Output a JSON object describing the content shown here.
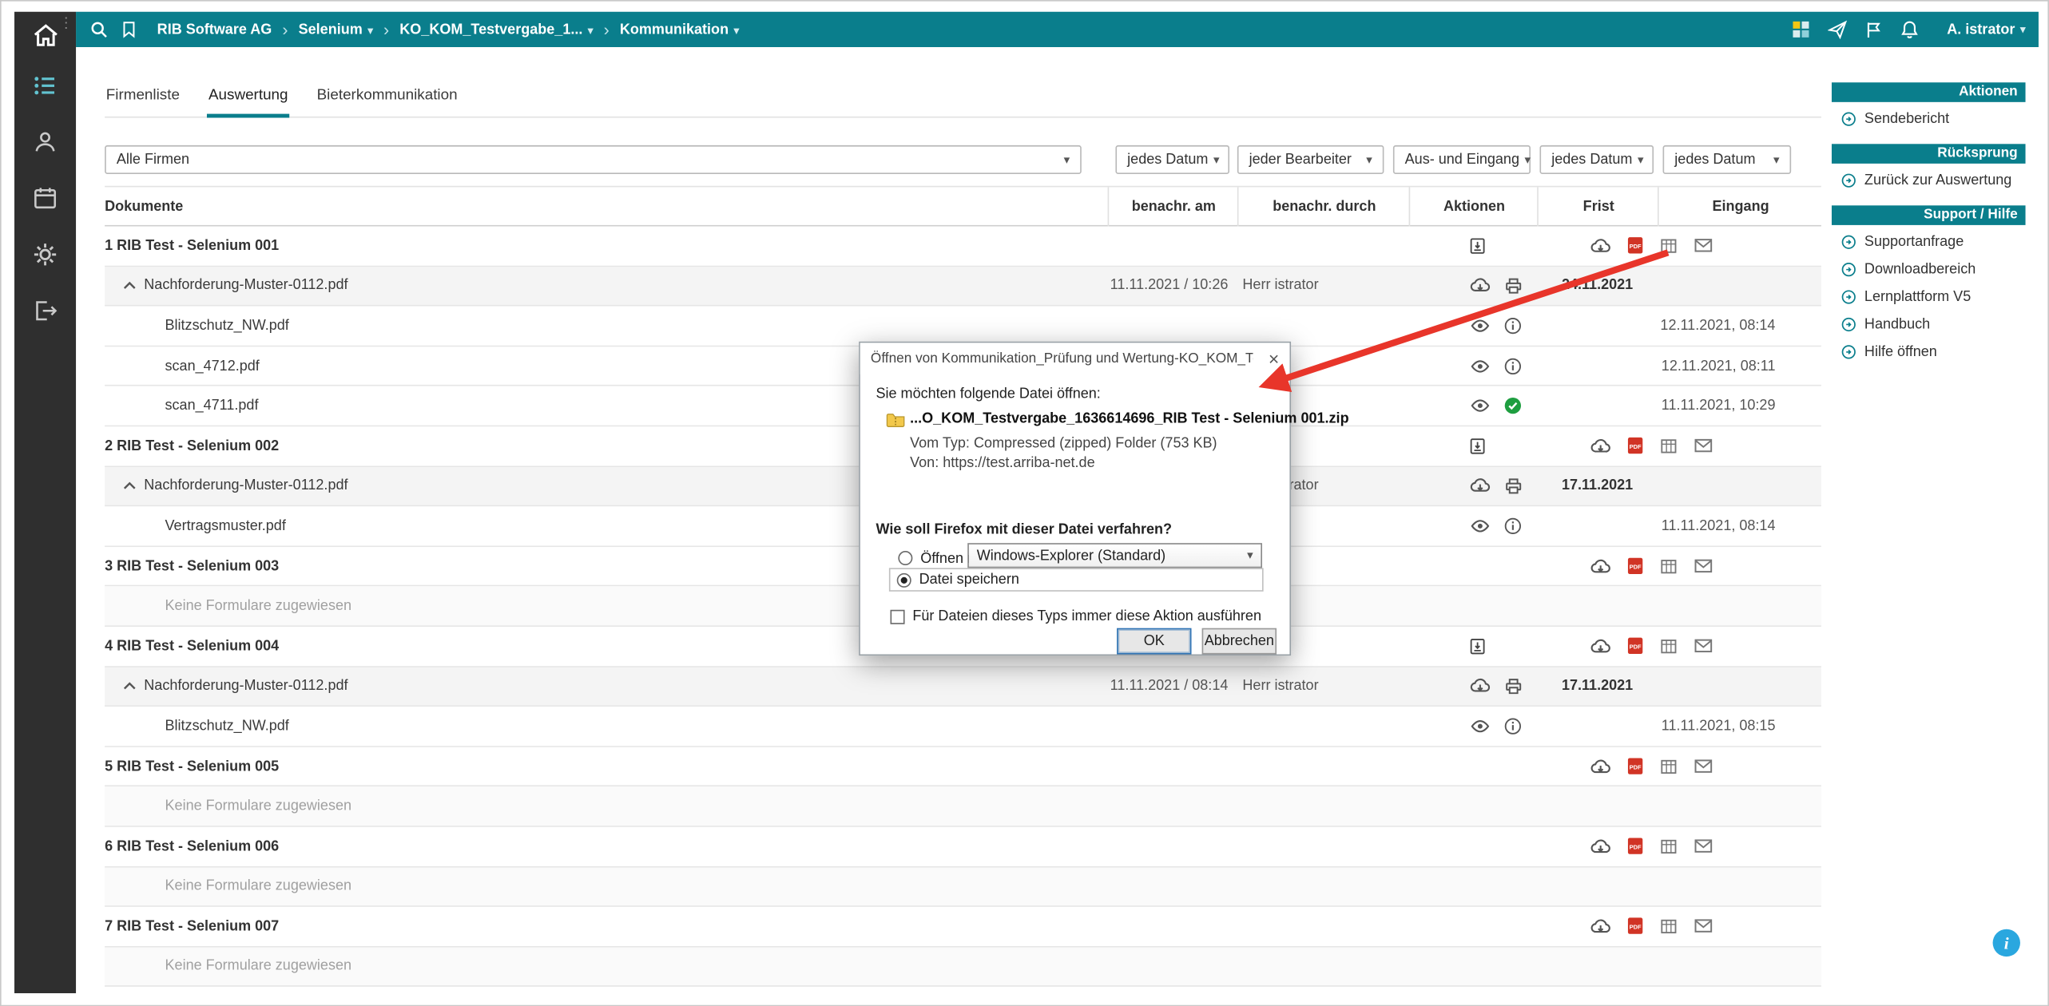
{
  "colors": {
    "teal": "#0a7e8c",
    "sidebar_bg": "#2f2f2f",
    "arrow_red": "#e8352a",
    "success_green": "#1e9e40",
    "pdf_red": "#d13425",
    "info_blue": "#2aa7df"
  },
  "topbar": {
    "left_icons": [
      "search-icon",
      "bookmark-icon"
    ],
    "breadcrumb": [
      {
        "label": "RIB Software AG",
        "dropdown": false
      },
      {
        "label": "Selenium",
        "dropdown": true
      },
      {
        "label": "KO_KOM_Testvergabe_1...",
        "dropdown": true
      },
      {
        "label": "Kommunikation",
        "dropdown": true
      }
    ],
    "right_icons": [
      "apps-icon",
      "send-icon",
      "flag-icon",
      "bell-icon"
    ],
    "user_label": "A. istrator"
  },
  "sidebar_icons": [
    "home",
    "worklist",
    "contacts",
    "calendar",
    "settings",
    "logout"
  ],
  "tabs": [
    {
      "label": "Firmenliste",
      "active": false
    },
    {
      "label": "Auswertung",
      "active": true
    },
    {
      "label": "Bieterkommunikation",
      "active": false
    }
  ],
  "filters": [
    {
      "value": "Alle Firmen"
    },
    {
      "value": "jedes Datum"
    },
    {
      "value": "jeder Bearbeiter"
    },
    {
      "value": "Aus- und Eingang"
    },
    {
      "value": "jedes Datum"
    },
    {
      "value": "jedes Datum"
    }
  ],
  "table": {
    "columns": [
      "Dokumente",
      "benachr. am",
      "benachr. durch",
      "Aktionen",
      "Frist",
      "Eingang"
    ],
    "empty_text": "Keine Formulare zugewiesen",
    "rows": [
      {
        "type": "group",
        "name": "1 RIB Test - Selenium 001",
        "archive": true
      },
      {
        "type": "form",
        "name": "Nachforderung-Muster-0112.pdf",
        "notified_at": "11.11.2021 / 10:26",
        "notified_by": "Herr istrator",
        "deadline": "24.11.2021"
      },
      {
        "type": "file",
        "name": "Blitzschutz_NW.pdf",
        "status": "info",
        "received": "12.11.2021, 08:14"
      },
      {
        "type": "file",
        "name": "scan_4712.pdf",
        "status": "info",
        "received": "12.11.2021, 08:11"
      },
      {
        "type": "file",
        "name": "scan_4711.pdf",
        "status": "check",
        "received": "11.11.2021, 10:29"
      },
      {
        "type": "group",
        "name": "2 RIB Test - Selenium 002",
        "archive": true
      },
      {
        "type": "form",
        "name": "Nachforderung-Muster-0112.pdf",
        "notified_at": "",
        "notified_by": "Herr istrator",
        "deadline": "17.11.2021"
      },
      {
        "type": "file",
        "name": "Vertragsmuster.pdf",
        "status": "info",
        "received": "11.11.2021, 08:14"
      },
      {
        "type": "group",
        "name": "3 RIB Test - Selenium 003",
        "archive": false
      },
      {
        "type": "empty"
      },
      {
        "type": "group",
        "name": "4 RIB Test - Selenium 004",
        "archive": true
      },
      {
        "type": "form",
        "name": "Nachforderung-Muster-0112.pdf",
        "notified_at": "11.11.2021 / 08:14",
        "notified_by": "Herr istrator",
        "deadline": "17.11.2021"
      },
      {
        "type": "file",
        "name": "Blitzschutz_NW.pdf",
        "status": "info",
        "received": "11.11.2021, 08:15"
      },
      {
        "type": "group",
        "name": "5 RIB Test - Selenium 005",
        "archive": false
      },
      {
        "type": "empty"
      },
      {
        "type": "group",
        "name": "6 RIB Test - Selenium 006",
        "archive": false
      },
      {
        "type": "empty"
      },
      {
        "type": "group",
        "name": "7 RIB Test - Selenium 007",
        "archive": false
      },
      {
        "type": "empty"
      }
    ]
  },
  "right_panel": {
    "sections": [
      {
        "header": "Aktionen",
        "items": [
          "Sendebericht"
        ]
      },
      {
        "header": "Rücksprung",
        "items": [
          "Zurück zur Auswertung"
        ]
      },
      {
        "header": "Support / Hilfe",
        "items": [
          "Supportanfrage",
          "Downloadbereich",
          "Lernplattform V5",
          "Handbuch",
          "Hilfe öffnen"
        ]
      }
    ]
  },
  "dialog": {
    "title": "Öffnen von Kommunikation_Prüfung und Wertung-KO_KOM_Testvergabe…",
    "close_label": "×",
    "intro": "Sie möchten folgende Datei öffnen:",
    "filename": "...O_KOM_Testvergabe_1636614696_RIB Test - Selenium 001.zip",
    "file_type": "Vom Typ: Compressed (zipped) Folder (753 KB)",
    "file_source": "Von: https://test.arriba-net.de",
    "question": "Wie soll Firefox mit dieser Datei verfahren?",
    "open_with_label": "Öffnen mit",
    "open_with_value": "Windows-Explorer (Standard)",
    "save_label": "Datei speichern",
    "remember_label": "Für Dateien dieses Typs immer diese Aktion ausführen",
    "ok_label": "OK",
    "cancel_label": "Abbrechen"
  },
  "info_bubble": {
    "label": "i"
  }
}
